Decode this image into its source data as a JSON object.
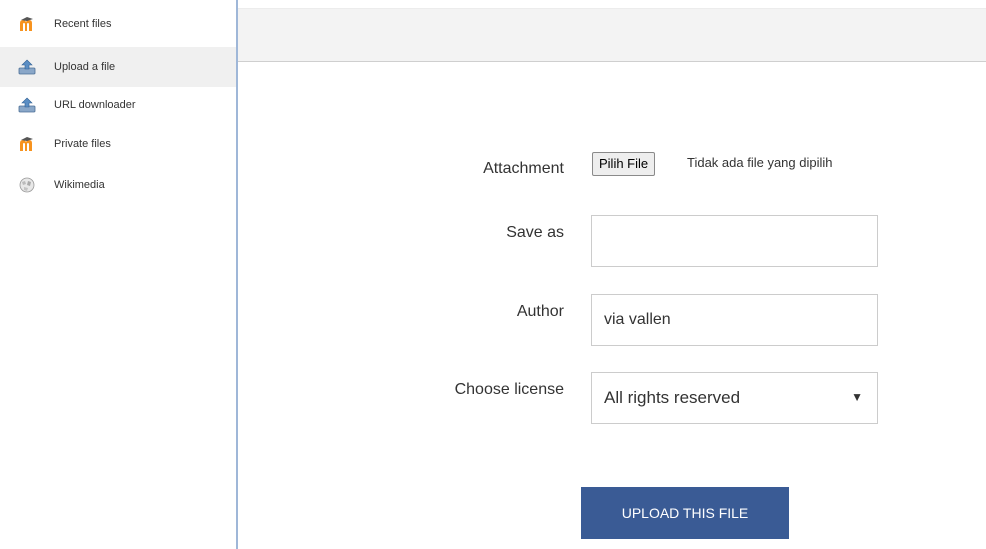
{
  "sidebar": {
    "items": [
      {
        "label": "Recent files",
        "icon": "moodle-logo-icon"
      },
      {
        "label": "Upload a file",
        "icon": "upload-icon"
      },
      {
        "label": "URL downloader",
        "icon": "url-download-icon"
      },
      {
        "label": "Private files",
        "icon": "moodle-logo-icon"
      },
      {
        "label": "Wikimedia",
        "icon": "wikimedia-globe-icon"
      }
    ],
    "active_item": "Upload a file"
  },
  "form": {
    "attachment_label": "Attachment",
    "file_button_label": "Pilih File",
    "file_status": "Tidak ada file yang dipilih",
    "save_as_label": "Save as",
    "save_as_value": "",
    "author_label": "Author",
    "author_value": "via vallen",
    "license_label": "Choose license",
    "license_value": "All rights reserved",
    "upload_button_label": "UPLOAD THIS FILE"
  },
  "colors": {
    "accent": "#3a5b95",
    "divider": "#9fb7d8",
    "active_sidebar_bg": "#f0f0f0",
    "moodle_orange": "#f7931e"
  }
}
